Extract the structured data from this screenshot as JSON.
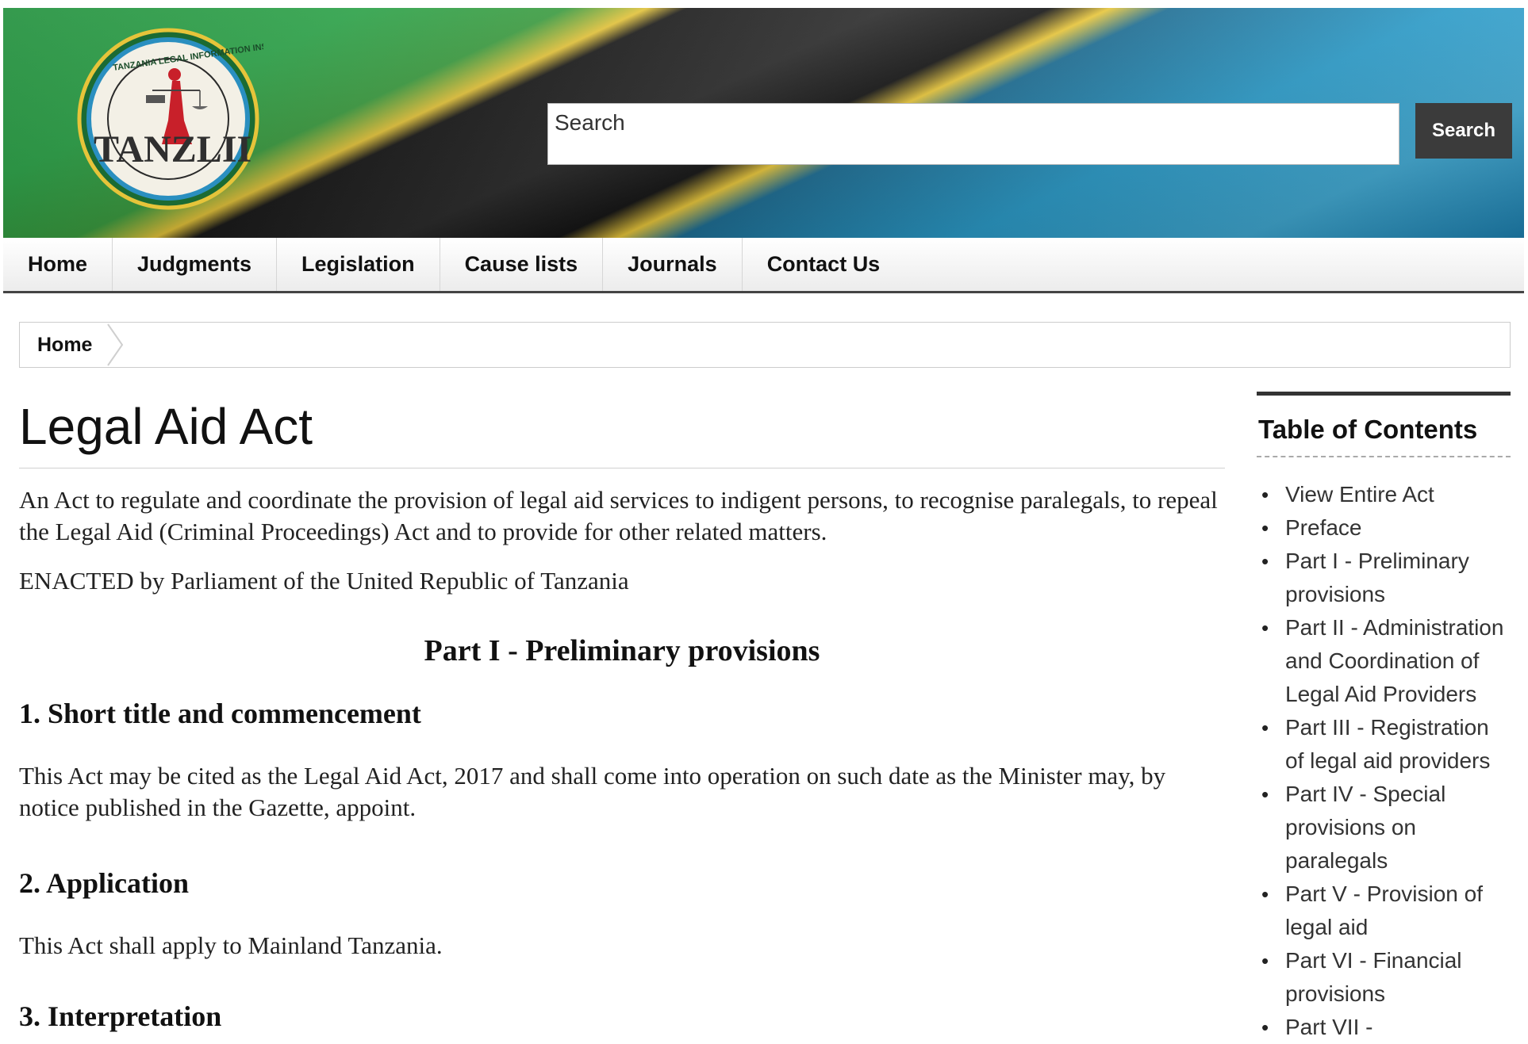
{
  "header": {
    "logo": {
      "ring_text": "TANZANIA LEGAL INFORMATION INSTITUTE",
      "wordmark": "TANZLII"
    },
    "search": {
      "placeholder": "Search",
      "button_label": "Search"
    }
  },
  "nav": {
    "items": [
      {
        "label": "Home"
      },
      {
        "label": "Judgments"
      },
      {
        "label": "Legislation"
      },
      {
        "label": "Cause lists"
      },
      {
        "label": "Journals"
      },
      {
        "label": "Contact Us"
      }
    ]
  },
  "breadcrumb": {
    "home": "Home"
  },
  "main": {
    "title": "Legal Aid Act",
    "long_title": "An Act to regulate and coordinate the provision of legal aid services to indigent persons, to recognise paralegals, to repeal the Legal Aid (Criminal Proceedings) Act and to provide for other related matters.",
    "enacting_formula": "ENACTED by Parliament of the United Republic of Tanzania",
    "part_heading": "Part I - Preliminary provisions",
    "sections": [
      {
        "heading": "1. Short title and commencement",
        "text": "This Act may be cited as the Legal Aid Act, 2017 and shall come into operation on such date as the Minister may, by notice published in the Gazette, appoint."
      },
      {
        "heading": "2. Application",
        "text": "This Act shall apply to Mainland Tanzania."
      },
      {
        "heading": "3. Interpretation",
        "text": ""
      }
    ]
  },
  "toc": {
    "title": "Table of Contents",
    "items": [
      "View Entire Act",
      "Preface",
      "Part I - Preliminary provisions",
      "Part II - Administration and Coordination of Legal Aid Providers",
      "Part III - Registration of legal aid providers",
      "Part IV - Special provisions on paralegals",
      "Part V - Provision of legal aid",
      "Part VI - Financial provisions",
      "Part VII -"
    ]
  },
  "colors": {
    "flag_green": "#1e8f3a",
    "flag_yellow": "#e2c23a",
    "flag_black": "#1a1a1a",
    "flag_blue": "#2b9ac7",
    "search_button": "#3b3b3b"
  }
}
